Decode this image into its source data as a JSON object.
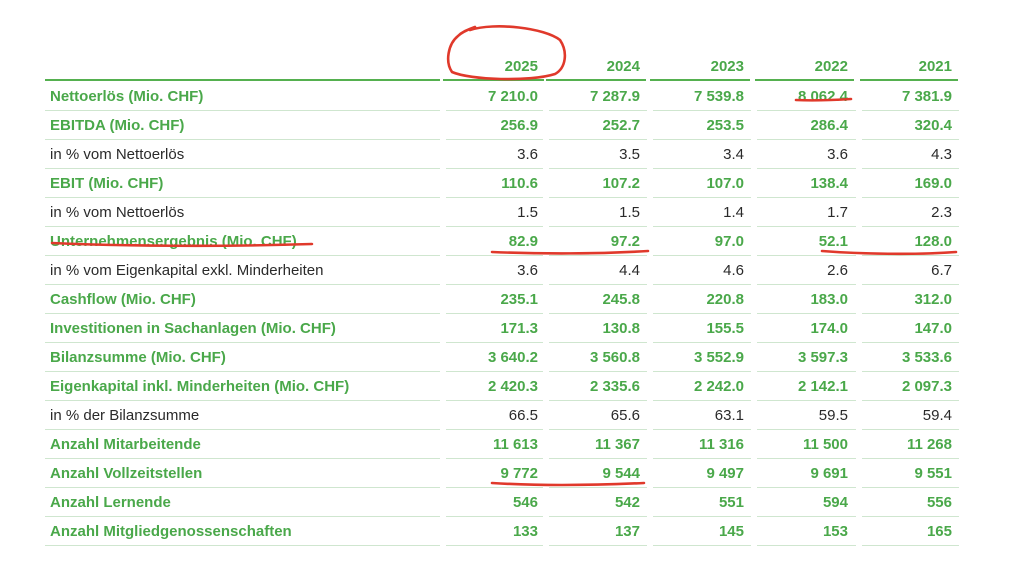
{
  "table": {
    "years": [
      "2025",
      "2024",
      "2023",
      "2022",
      "2021"
    ],
    "rows": [
      {
        "label": "Nettoerlös (Mio. CHF)",
        "style": "strong",
        "values": [
          "7 210.0",
          "7 287.9",
          "7 539.8",
          "8 062.4",
          "7 381.9"
        ]
      },
      {
        "label": "EBITDA (Mio. CHF)",
        "style": "strong",
        "values": [
          "256.9",
          "252.7",
          "253.5",
          "286.4",
          "320.4"
        ]
      },
      {
        "label": "in % vom Nettoerlös",
        "style": "plain",
        "values": [
          "3.6",
          "3.5",
          "3.4",
          "3.6",
          "4.3"
        ]
      },
      {
        "label": "EBIT (Mio. CHF)",
        "style": "strong",
        "values": [
          "110.6",
          "107.2",
          "107.0",
          "138.4",
          "169.0"
        ]
      },
      {
        "label": "in % vom Nettoerlös",
        "style": "plain",
        "values": [
          "1.5",
          "1.5",
          "1.4",
          "1.7",
          "2.3"
        ]
      },
      {
        "label": "Unternehmensergebnis (Mio. CHF)",
        "style": "strong",
        "values": [
          "82.9",
          "97.2",
          "97.0",
          "52.1",
          "128.0"
        ]
      },
      {
        "label": "in % vom Eigenkapital exkl. Minderheiten",
        "style": "plain",
        "values": [
          "3.6",
          "4.4",
          "4.6",
          "2.6",
          "6.7"
        ]
      },
      {
        "label": "Cashflow (Mio. CHF)",
        "style": "strong",
        "values": [
          "235.1",
          "245.8",
          "220.8",
          "183.0",
          "312.0"
        ]
      },
      {
        "label": "Investitionen in Sachanlagen (Mio. CHF)",
        "style": "strong",
        "values": [
          "171.3",
          "130.8",
          "155.5",
          "174.0",
          "147.0"
        ]
      },
      {
        "label": "Bilanzsumme (Mio. CHF)",
        "style": "strong",
        "values": [
          "3 640.2",
          "3 560.8",
          "3 552.9",
          "3 597.3",
          "3 533.6"
        ]
      },
      {
        "label": "Eigenkapital inkl. Minderheiten (Mio. CHF)",
        "style": "strong",
        "values": [
          "2 420.3",
          "2 335.6",
          "2 242.0",
          "2 142.1",
          "2 097.3"
        ]
      },
      {
        "label": "in % der Bilanzsumme",
        "style": "plain",
        "values": [
          "66.5",
          "65.6",
          "63.1",
          "59.5",
          "59.4"
        ]
      },
      {
        "label": "Anzahl Mitarbeitende",
        "style": "strong",
        "values": [
          "11 613",
          "11 367",
          "11 316",
          "11 500",
          "11 268"
        ]
      },
      {
        "label": "Anzahl Vollzeitstellen",
        "style": "strong",
        "values": [
          "9 772",
          "9 544",
          "9 497",
          "9 691",
          "9 551"
        ]
      },
      {
        "label": "Anzahl Lernende",
        "style": "strong",
        "values": [
          "546",
          "542",
          "551",
          "594",
          "556"
        ]
      },
      {
        "label": "Anzahl Mitgliedgenossenschaften",
        "style": "strong",
        "values": [
          "133",
          "137",
          "145",
          "153",
          "165"
        ]
      }
    ]
  },
  "colors": {
    "green": "#4aa84a",
    "annotation_red": "#e0392b"
  },
  "annotations": {
    "circled": [
      "2025"
    ],
    "underlined": [
      "8 062.4",
      "Unternehmensergebnis (Mio. CHF)",
      "82.9",
      "97.2",
      "52.1",
      "128.0",
      "9 772",
      "9 544"
    ]
  }
}
